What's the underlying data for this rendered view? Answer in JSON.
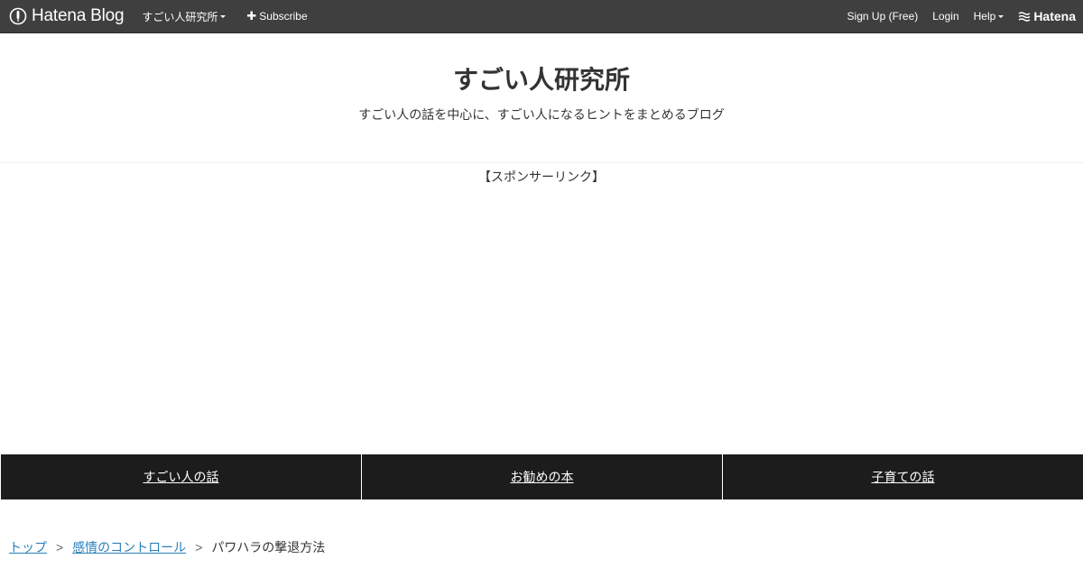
{
  "globalbar": {
    "logo_text": "Hatena Blog",
    "blog_name": "すごい人研究所",
    "subscribe_label": "Subscribe",
    "signup_label": "Sign Up (Free)",
    "login_label": "Login",
    "help_label": "Help",
    "hatena_label": "Hatena",
    "bar_color": "#3f3f3f"
  },
  "header": {
    "title": "すごい人研究所",
    "description": "すごい人の話を中心に、すごい人になるヒントをまとめるブログ"
  },
  "sponsor": {
    "label": "【スポンサーリンク】"
  },
  "category_nav": {
    "items": [
      {
        "label": "すごい人の話"
      },
      {
        "label": "お勧めの本"
      },
      {
        "label": "子育ての話"
      }
    ],
    "bg_color": "#1c1c1c"
  },
  "breadcrumb": {
    "items": [
      {
        "label": "トップ"
      },
      {
        "label": "感情のコントロール"
      },
      {
        "label": "パワハラの撃退方法"
      }
    ],
    "separator": ">",
    "link_color": "#2a7fb8"
  }
}
